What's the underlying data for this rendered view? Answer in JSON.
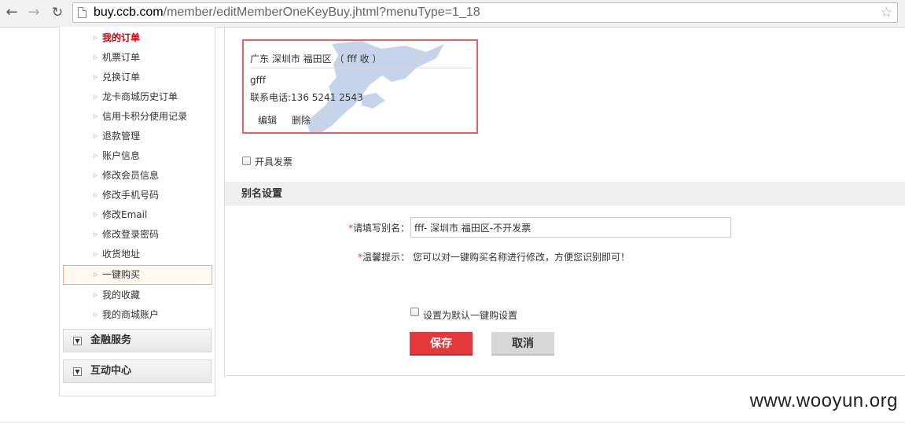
{
  "browser": {
    "url_host": "buy.ccb.com",
    "url_path": "/member/editMemberOneKeyBuy.jhtml?menuType=1_18"
  },
  "sidebar": {
    "items": [
      {
        "label": "我的订单"
      },
      {
        "label": "机票订单"
      },
      {
        "label": "兑换订单"
      },
      {
        "label": "龙卡商城历史订单"
      },
      {
        "label": "信用卡积分使用记录"
      },
      {
        "label": "退款管理"
      },
      {
        "label": "账户信息"
      },
      {
        "label": "修改会员信息"
      },
      {
        "label": "修改手机号码"
      },
      {
        "label": "修改Email"
      },
      {
        "label": "修改登录密码"
      },
      {
        "label": "收货地址"
      },
      {
        "label": "一键购买"
      },
      {
        "label": "我的收藏"
      },
      {
        "label": "我的商城账户"
      }
    ],
    "sections": [
      {
        "label": "金融服务"
      },
      {
        "label": "互动中心"
      }
    ]
  },
  "address_card": {
    "title": "广东 深圳市 福田区 （ fff 收 ）",
    "name": "gfff",
    "phone": "联系电话:136 5241 2543",
    "edit_label": "编辑",
    "delete_label": "删除"
  },
  "invoice_checkbox": {
    "label": "开具发票",
    "checked": false
  },
  "alias_section": {
    "title": "别名设置"
  },
  "alias_form": {
    "required_mark": "*",
    "label": "请填写别名：",
    "value": "fff- 深圳市 福田区-不开发票",
    "hint_label": "温馨提示：",
    "hint_text": "您可以对一键购买名称进行修改，方便您识别即可！"
  },
  "default_checkbox": {
    "label": "设置为默认一键购设置",
    "checked": false
  },
  "buttons": {
    "save": "保存",
    "cancel": "取消"
  },
  "watermark": "www.wooyun.org",
  "colors": {
    "accent_red": "#e4393c",
    "card_border": "#e86060",
    "map_fill": "#c5d4ea"
  }
}
